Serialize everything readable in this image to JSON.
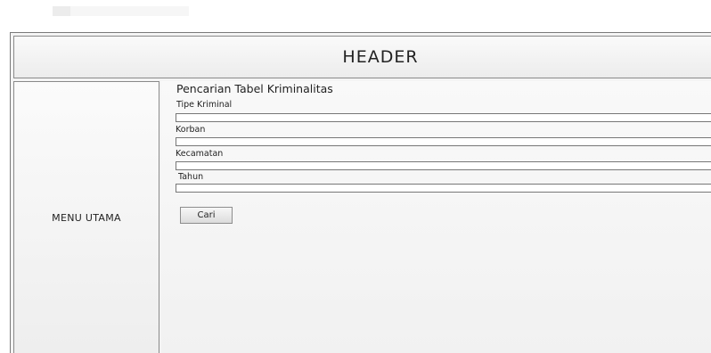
{
  "header": {
    "title": "HEADER"
  },
  "sidebar": {
    "label": "MENU UTAMA"
  },
  "form": {
    "title": "Pencarian Tabel Kriminalitas",
    "fields": [
      {
        "label": "Tipe Kriminal",
        "value": ""
      },
      {
        "label": "Korban",
        "value": ""
      },
      {
        "label": "Kecamatan",
        "value": ""
      },
      {
        "label": "Tahun",
        "value": ""
      }
    ],
    "submit_label": "Cari"
  }
}
